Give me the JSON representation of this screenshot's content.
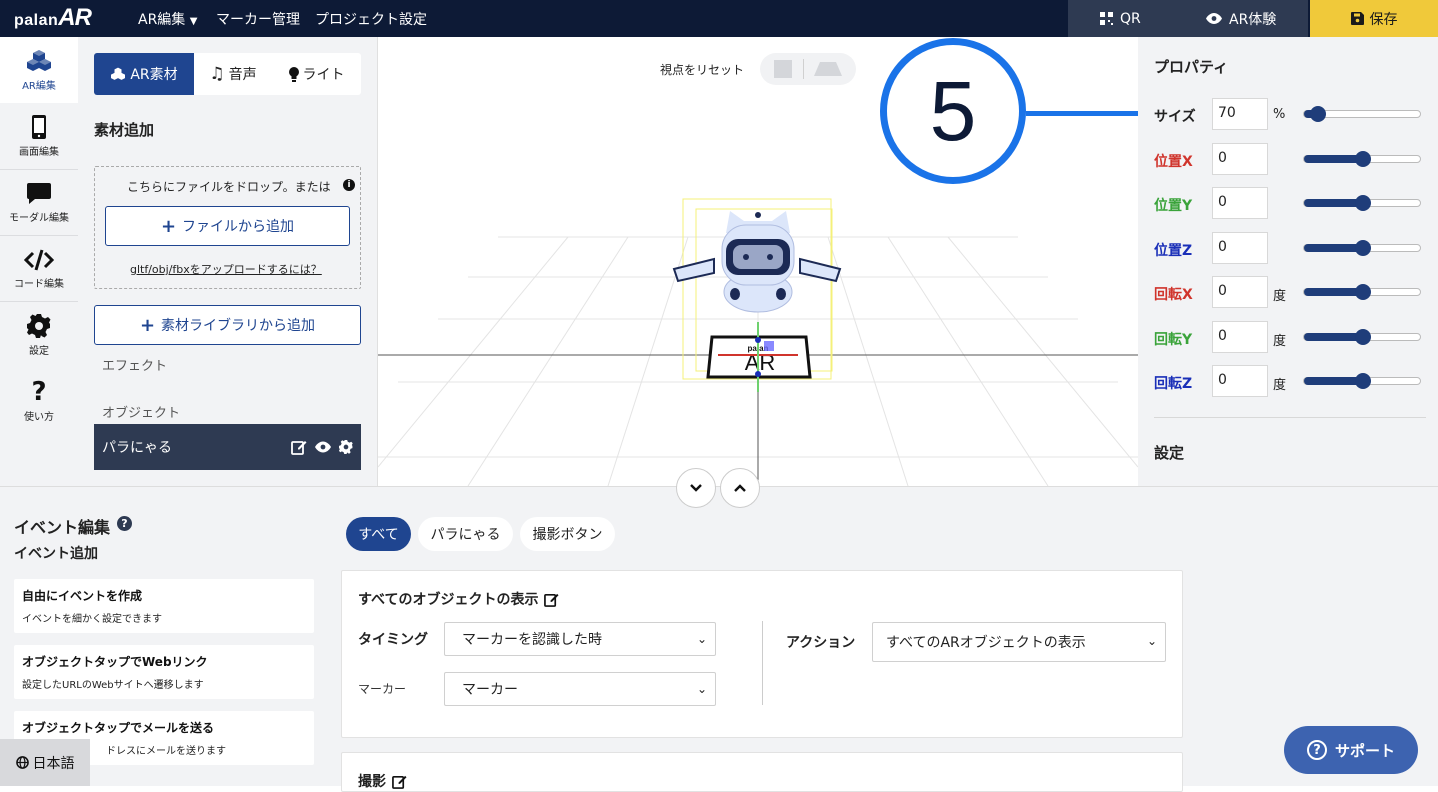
{
  "app": {
    "logo_prefix": "palan",
    "logo_suffix": "AR"
  },
  "topbar": {
    "menu": [
      "AR編集",
      "マーカー管理",
      "プロジェクト設定"
    ],
    "qr_label": "QR",
    "experience_label": "AR体験",
    "save_label": "保存"
  },
  "rail": [
    {
      "label": "AR編集",
      "icon": "cubes-icon"
    },
    {
      "label": "画面編集",
      "icon": "phone-icon"
    },
    {
      "label": "モーダル編集",
      "icon": "chat-bubble-icon"
    },
    {
      "label": "コード編集",
      "icon": "code-icon"
    },
    {
      "label": "設定",
      "icon": "gear-icon"
    },
    {
      "label": "使い方",
      "icon": "question-icon"
    }
  ],
  "left_panel": {
    "tabs": [
      "AR素材",
      "音声",
      "ライト"
    ],
    "section_title": "素材追加",
    "drop_text": "こちらにファイルをドロップ。または",
    "add_file_label": "ファイルから追加",
    "upload_help_link": "gltf/obj/fbxをアップロードするには？",
    "library_label": "素材ライブラリから追加",
    "effect_label": "エフェクト",
    "object_label": "オブジェクト",
    "object_name": "パラにゃる"
  },
  "viewport": {
    "reset_label": "視点をリセット",
    "callout_number": "5",
    "marker_text": "AR",
    "marker_brand": "palan"
  },
  "properties": {
    "title": "プロパティ",
    "rows": [
      {
        "label": "サイズ",
        "value": "70",
        "unit": "%",
        "color": "#222222",
        "slider": 0.12
      },
      {
        "label": "位置X",
        "value": "0",
        "unit": "",
        "color": "#d0342c",
        "slider": 0.5
      },
      {
        "label": "位置Y",
        "value": "0",
        "unit": "",
        "color": "#3aa33a",
        "slider": 0.5
      },
      {
        "label": "位置Z",
        "value": "0",
        "unit": "",
        "color": "#1a2fb8",
        "slider": 0.5
      },
      {
        "label": "回転X",
        "value": "0",
        "unit": "度",
        "color": "#d0342c",
        "slider": 0.5
      },
      {
        "label": "回転Y",
        "value": "0",
        "unit": "度",
        "color": "#3aa33a",
        "slider": 0.5
      },
      {
        "label": "回転Z",
        "value": "0",
        "unit": "度",
        "color": "#1a2fb8",
        "slider": 0.5
      }
    ],
    "settings_title": "設定"
  },
  "events": {
    "title": "イベント編集",
    "add_title": "イベント追加",
    "templates": [
      {
        "title": "自由にイベントを作成",
        "desc": "イベントを細かく設定できます"
      },
      {
        "title": "オブジェクトタップでWebリンク",
        "desc": "設定したURLのWebサイトへ遷移します"
      },
      {
        "title": "オブジェクトタップでメールを送る",
        "desc": "ドレスにメールを送ります"
      }
    ],
    "filters": [
      "すべて",
      "パラにゃる",
      "撮影ボタン"
    ],
    "card1": {
      "title": "すべてのオブジェクトの表示",
      "timing_label": "タイミング",
      "timing_value": "マーカーを認識した時",
      "marker_label": "マーカー",
      "marker_value": "マーカー",
      "action_label": "アクション",
      "action_value": "すべてのARオブジェクトの表示"
    },
    "card2": {
      "title": "撮影"
    }
  },
  "language_label": "日本語",
  "support_label": "サポート",
  "colors": {
    "navy": "#0d1a36",
    "primary": "#1f4590",
    "save": "#f0c93a",
    "callout": "#1a73e8"
  }
}
